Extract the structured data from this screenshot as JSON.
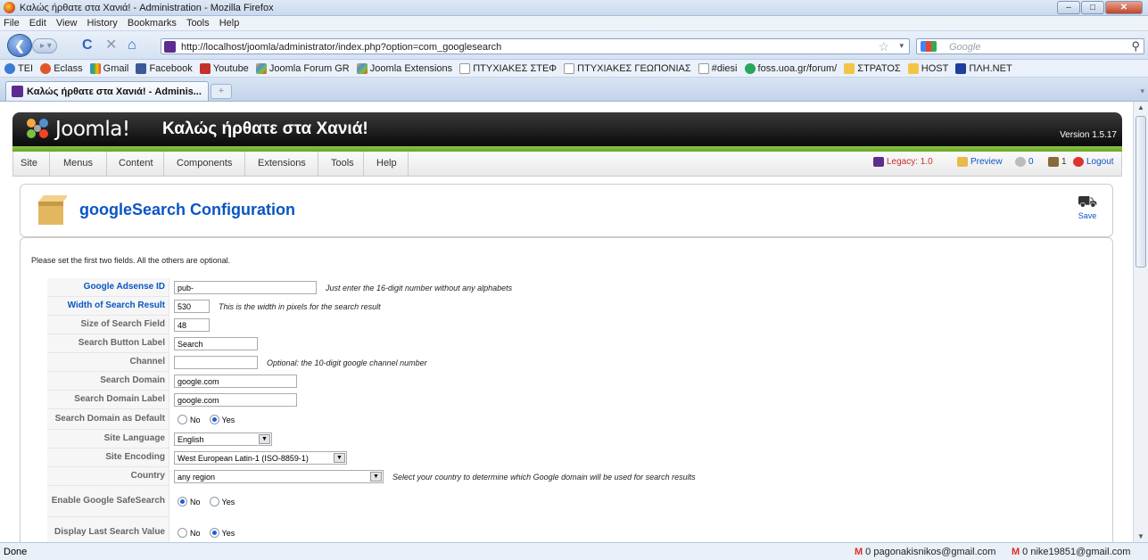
{
  "window": {
    "title": "Καλώς ήρθατε στα Χανιά! - Administration - Mozilla Firefox"
  },
  "menubar": [
    "File",
    "Edit",
    "View",
    "History",
    "Bookmarks",
    "Tools",
    "Help"
  ],
  "nav": {
    "url": "http://localhost/joomla/administrator/index.php?option=com_googlesearch",
    "search_placeholder": "Google"
  },
  "bookmarks": [
    "TEI",
    "Eclass",
    "Gmail",
    "Facebook",
    "Youtube",
    "Joomla Forum GR",
    "Joomla Extensions",
    "ΠΤΥΧΙΑΚΕΣ ΣΤΕΦ",
    "ΠΤΥΧΙΑΚΕΣ ΓΕΩΠΟΝΙΑΣ",
    "#diesi",
    "foss.uoa.gr/forum/",
    "ΣΤΡΑΤΟΣ",
    "HOST",
    "ΠΛΗ.NET"
  ],
  "tab": {
    "label": "Καλώς ήρθατε στα Χανιά! - Adminis..."
  },
  "joomla": {
    "brand": "Joomla!",
    "site_name": "Καλώς ήρθατε στα Χανιά!",
    "version": "Version 1.5.17",
    "menu": [
      "Site",
      "Menus",
      "Content",
      "Components",
      "Extensions",
      "Tools",
      "Help"
    ],
    "status": {
      "legacy": "Legacy: 1.0",
      "preview": "Preview",
      "messages": "0",
      "users": "1",
      "logout": "Logout"
    }
  },
  "page": {
    "title": "googleSearch Configuration",
    "save_label": "Save",
    "note": "Please set the first two fields. All the others are optional."
  },
  "form": {
    "adsense_label": "Google Adsense ID",
    "adsense_value": "pub-",
    "adsense_hint": "Just enter the 16-digit number without any alphabets",
    "width_label": "Width of Search Result",
    "width_value": "530",
    "width_hint": "This is the width in pixels for the search result",
    "size_label": "Size of Search Field",
    "size_value": "48",
    "button_label": "Search Button Label",
    "button_value": "Search",
    "channel_label": "Channel",
    "channel_value": "",
    "channel_hint": "Optional: the 10-digit google channel number",
    "domain_label": "Search Domain",
    "domain_value": "google.com",
    "domain_label_label": "Search Domain Label",
    "domain_label_value": "google.com",
    "default_label": "Search Domain as Default",
    "language_label": "Site Language",
    "language_value": "English",
    "encoding_label": "Site Encoding",
    "encoding_value": "West European Latin-1 (ISO-8859-1)",
    "country_label": "Country",
    "country_value": "any region",
    "country_hint": "Select your country to determine which Google domain will be used for search results",
    "safesearch_label": "Enable Google SafeSearch",
    "lastsearch_label": "Display Last Search Value",
    "no": "No",
    "yes": "Yes"
  },
  "statusbar": {
    "left": "Done",
    "mail1": "0 pagonakisnikos@gmail.com",
    "mail2": "0 nike19851@gmail.com"
  }
}
